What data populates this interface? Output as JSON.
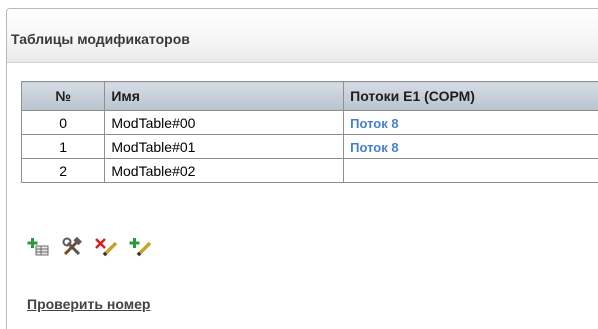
{
  "panel": {
    "title": "Таблицы модификаторов"
  },
  "table": {
    "headers": {
      "num": "№",
      "name": "Имя",
      "flows": "Потоки E1 (СОРМ)"
    },
    "rows": [
      {
        "num": "0",
        "name": "ModTable#00",
        "flows": "Поток 8"
      },
      {
        "num": "1",
        "name": "ModTable#01",
        "flows": "Поток 8"
      },
      {
        "num": "2",
        "name": "ModTable#02",
        "flows": ""
      }
    ]
  },
  "toolbar": {
    "buttons": [
      {
        "icon": "add-table-icon"
      },
      {
        "icon": "tools-icon"
      },
      {
        "icon": "delete-edit-icon"
      },
      {
        "icon": "add-edit-icon"
      }
    ]
  },
  "links": {
    "check_number": "Проверить номер"
  },
  "colors": {
    "header_bg": "#c8d0d9",
    "link": "#4a7fd0",
    "border": "#8f8f8f"
  }
}
